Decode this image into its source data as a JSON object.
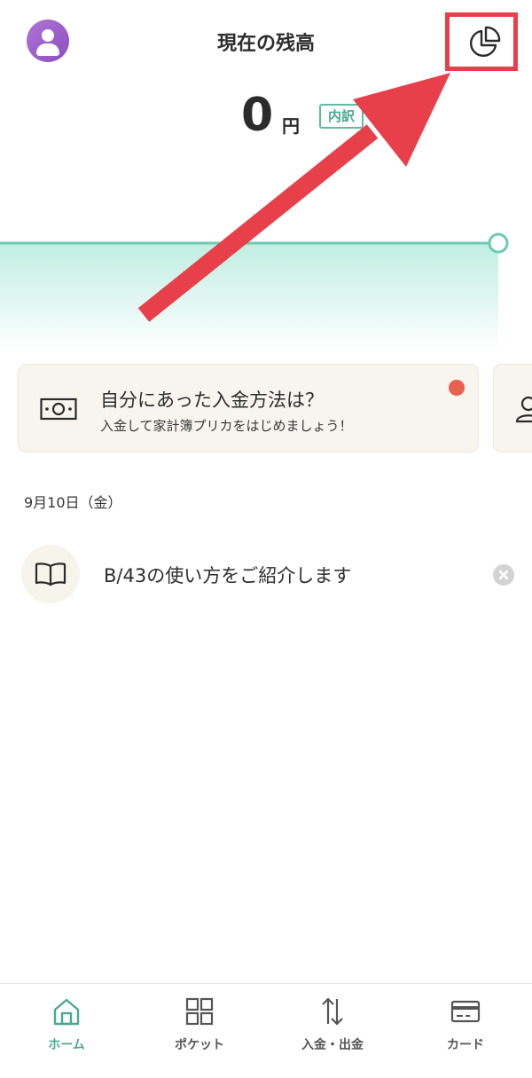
{
  "header": {
    "title": "現在の残高"
  },
  "balance": {
    "amount": "0",
    "currency": "円",
    "breakdown_label": "内訳"
  },
  "promo_card": {
    "title": "自分にあった入金方法は？",
    "subtitle": "入金して家計簿プリカをはじめましょう！"
  },
  "timeline": {
    "date": "9月10日（金）",
    "items": [
      {
        "text": "B/43の使い方をご紹介します"
      }
    ]
  },
  "nav": {
    "items": [
      {
        "label": "ホーム",
        "icon": "home-icon",
        "active": true
      },
      {
        "label": "ポケット",
        "icon": "grid-icon",
        "active": false
      },
      {
        "label": "入金・出金",
        "icon": "transfer-icon",
        "active": false
      },
      {
        "label": "カード",
        "icon": "card-icon",
        "active": false
      }
    ]
  },
  "colors": {
    "accent": "#4aa892",
    "highlight_red": "#e8404a",
    "notification_dot": "#e8604f"
  }
}
